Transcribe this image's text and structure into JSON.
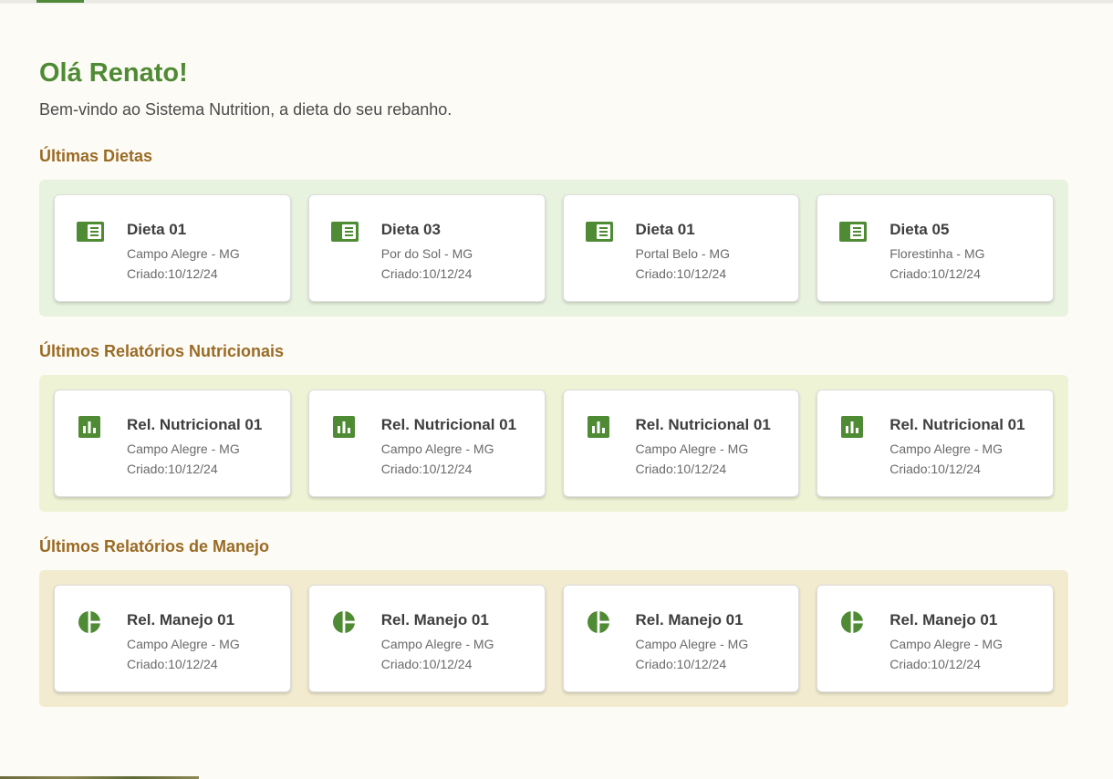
{
  "greeting": "Olá Renato!",
  "subtitle": "Bem-vindo ao Sistema Nutrition, a dieta do seu rebanho.",
  "colors": {
    "accent": "#4f8a34",
    "section_title": "#9a6b24",
    "diet_panel_bg": "#e8f3df",
    "nutri_panel_bg": "#eef3d6",
    "manejo_panel_bg": "#f2ebcf"
  },
  "sections": {
    "diets": {
      "title": "Últimas Dietas",
      "icon": "diet-book-icon",
      "cards": [
        {
          "title": "Dieta 01",
          "location": "Campo Alegre - MG",
          "created": "Criado:10/12/24"
        },
        {
          "title": "Dieta 03",
          "location": "Por do Sol - MG",
          "created": "Criado:10/12/24"
        },
        {
          "title": "Dieta 01",
          "location": "Portal Belo - MG",
          "created": "Criado:10/12/24"
        },
        {
          "title": "Dieta 05",
          "location": "Florestinha - MG",
          "created": "Criado:10/12/24"
        }
      ]
    },
    "nutritional": {
      "title": "Últimos Relatórios Nutricionais",
      "icon": "bar-chart-icon",
      "cards": [
        {
          "title": "Rel. Nutricional 01",
          "location": "Campo Alegre - MG",
          "created": "Criado:10/12/24"
        },
        {
          "title": "Rel. Nutricional 01",
          "location": "Campo Alegre - MG",
          "created": "Criado:10/12/24"
        },
        {
          "title": "Rel. Nutricional 01",
          "location": "Campo Alegre - MG",
          "created": "Criado:10/12/24"
        },
        {
          "title": "Rel. Nutricional 01",
          "location": "Campo Alegre - MG",
          "created": "Criado:10/12/24"
        }
      ]
    },
    "management": {
      "title": "Últimos Relatórios de Manejo",
      "icon": "pie-chart-icon",
      "cards": [
        {
          "title": "Rel. Manejo 01",
          "location": "Campo Alegre - MG",
          "created": "Criado:10/12/24"
        },
        {
          "title": "Rel. Manejo 01",
          "location": "Campo Alegre - MG",
          "created": "Criado:10/12/24"
        },
        {
          "title": "Rel. Manejo 01",
          "location": "Campo Alegre - MG",
          "created": "Criado:10/12/24"
        },
        {
          "title": "Rel. Manejo 01",
          "location": "Campo Alegre - MG",
          "created": "Criado:10/12/24"
        }
      ]
    }
  }
}
